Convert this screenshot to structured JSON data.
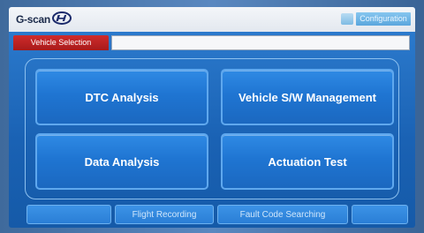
{
  "header": {
    "logo_text": "G-scan",
    "config_label": "Configuration"
  },
  "vehicle_selection": {
    "label": "Vehicle Selection",
    "value": ""
  },
  "main_menu": {
    "dtc_analysis": "DTC Analysis",
    "vehicle_sw_management": "Vehicle S/W Management",
    "data_analysis": "Data Analysis",
    "actuation_test": "Actuation Test"
  },
  "bottom_bar": {
    "button_1": "",
    "flight_recording": "Flight Recording",
    "fault_code_searching": "Fault Code Searching",
    "button_4": ""
  },
  "colors": {
    "accent_red": "#b82020",
    "button_blue": "#1f75d2"
  }
}
